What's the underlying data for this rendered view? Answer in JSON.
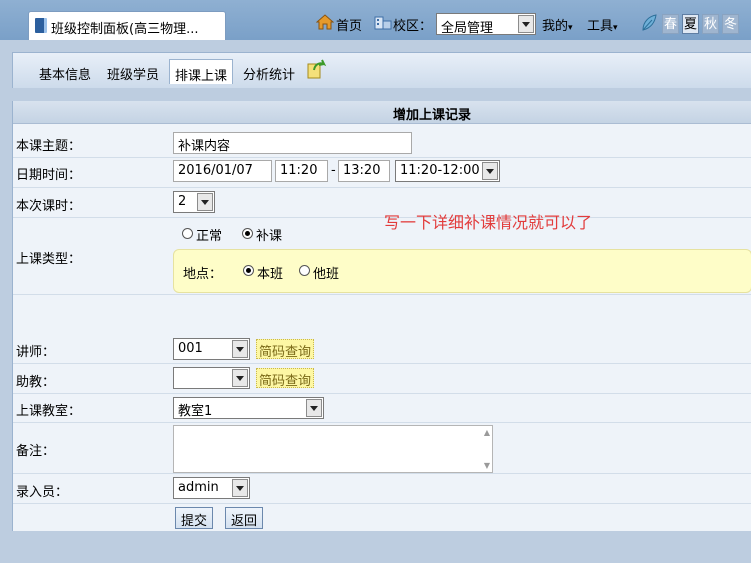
{
  "window_tab": {
    "title": "班级控制面板(高三物理..."
  },
  "topnav": {
    "home": "首页",
    "school_label": "校区：",
    "school_value": "全局管理",
    "mine": "我的",
    "tools": "工具",
    "arrow": "▾",
    "seasons": [
      "春",
      "夏",
      "秋",
      "冬"
    ],
    "active_season": "夏"
  },
  "subnav": {
    "tabs": [
      "基本信息",
      "班级学员",
      "排课上课",
      "分析统计"
    ],
    "active": "排课上课"
  },
  "form": {
    "title": "增加上课记录",
    "topic": {
      "label": "本课主题：",
      "value": "补课内容"
    },
    "datetime": {
      "label": "日期时间：",
      "date": "2016/01/07",
      "start": "11:20",
      "sep": "-",
      "end": "13:20",
      "range": "11:20-12:00"
    },
    "hours": {
      "label": "本次课时：",
      "value": "2"
    },
    "type": {
      "label": "上课类型：",
      "options": [
        "正常",
        "补课"
      ],
      "selected": "补课",
      "location_label": "地点：",
      "location_options": [
        "本班",
        "他班"
      ],
      "location_selected": "本班"
    },
    "teacher": {
      "label": "讲师：",
      "value": "001",
      "lookup": "简码查询"
    },
    "assistant": {
      "label": "助教：",
      "value": "",
      "lookup": "简码查询"
    },
    "classroom": {
      "label": "上课教室：",
      "value": "教室1"
    },
    "remark": {
      "label": "备注：",
      "value": ""
    },
    "operator": {
      "label": "录入员：",
      "value": "admin"
    },
    "submit": "提交",
    "back": "返回"
  },
  "annotation": "写一下详细补课情况就可以了",
  "colors": {
    "annotation": "#e23c3c",
    "lookup_bg": "#fdf7a4",
    "panel_bg": "#eef3f9"
  }
}
